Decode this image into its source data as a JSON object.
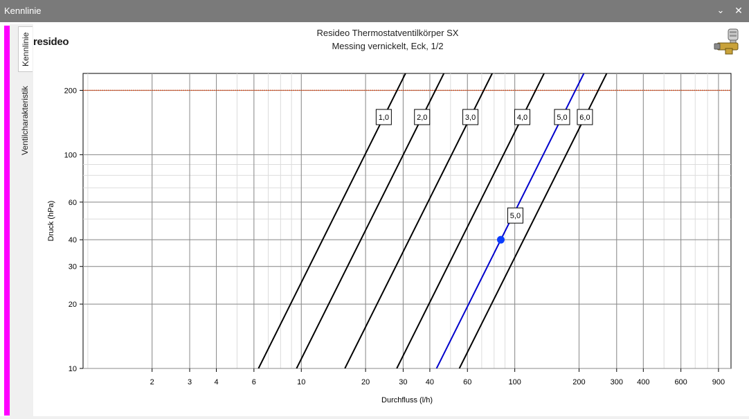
{
  "window": {
    "title": "Kennlinie",
    "minimize_glyph": "⌄",
    "close_glyph": "✕"
  },
  "tabs": [
    {
      "label": "Kennlinie",
      "active": true
    },
    {
      "label": "Ventilcharakteristik",
      "active": false
    }
  ],
  "brand": {
    "logo_text": "resideo",
    "accent_color": "#ff00ff"
  },
  "product_icon": "thermostatic-valve-icon",
  "chart_data": {
    "type": "line",
    "title": "Resideo Thermostatventilkörper SX",
    "subtitle": "Messing vernickelt, Eck, 1/2",
    "xlabel": "Durchfluss (l/h)",
    "ylabel": "Druck (hPa)",
    "x_scale": "log",
    "y_scale": "log",
    "xlim": [
      0.95,
      1030
    ],
    "ylim": [
      10,
      240
    ],
    "x_ticks": [
      2,
      3,
      4,
      6,
      10,
      20,
      30,
      40,
      60,
      100,
      200,
      300,
      400,
      600,
      900
    ],
    "y_ticks": [
      10,
      20,
      30,
      40,
      60,
      100,
      200
    ],
    "grid": true,
    "reference_line": {
      "y": 200,
      "color": "#d24a1a",
      "style": "dotted"
    },
    "series": [
      {
        "name": "1,0",
        "color": "#000000",
        "label_y": 150,
        "points": [
          [
            6.3,
            10
          ],
          [
            31.4,
            250
          ]
        ]
      },
      {
        "name": "2,0",
        "color": "#000000",
        "label_y": 150,
        "points": [
          [
            9.5,
            10
          ],
          [
            47.5,
            250
          ]
        ]
      },
      {
        "name": "3,0",
        "color": "#000000",
        "label_y": 150,
        "points": [
          [
            16.0,
            10
          ],
          [
            80.0,
            250
          ]
        ]
      },
      {
        "name": "4,0",
        "color": "#000000",
        "label_y": 150,
        "points": [
          [
            28.0,
            10
          ],
          [
            140.0,
            250
          ]
        ]
      },
      {
        "name": "5,0",
        "color": "#0000cc",
        "label_y": 150,
        "points": [
          [
            43.0,
            10
          ],
          [
            215.0,
            250
          ]
        ]
      },
      {
        "name": "6,0",
        "color": "#000000",
        "label_y": 150,
        "points": [
          [
            55.0,
            10
          ],
          [
            275.0,
            250
          ]
        ]
      }
    ],
    "operating_point": {
      "x": 86,
      "y": 40,
      "label": "5,0",
      "color": "#0a3cff"
    }
  }
}
